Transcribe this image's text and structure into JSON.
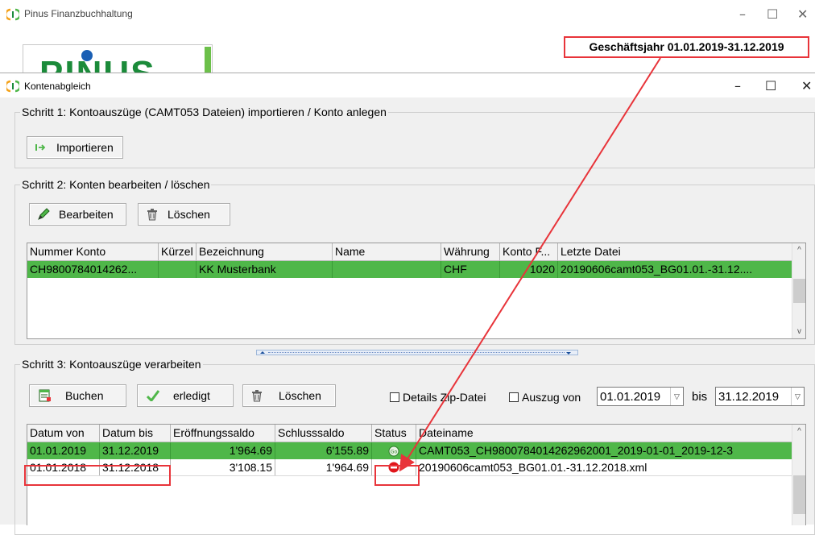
{
  "main_window": {
    "title": "Pinus Finanzbuchhaltung",
    "logo_text": "PINUS"
  },
  "annotation": {
    "fiscal_year": "Geschäftsjahr 01.01.2019-31.12.2019"
  },
  "dialog": {
    "title": "Kontenabgleich"
  },
  "step1": {
    "legend": "Schritt 1: Kontoauszüge (CAMT053 Dateien) importieren / Konto anlegen",
    "import_button": "Importieren"
  },
  "step2": {
    "legend": "Schritt 2: Konten bearbeiten / löschen",
    "edit_button": "Bearbeiten",
    "delete_button": "Löschen",
    "columns": [
      "Nummer Konto",
      "Kürzel",
      "Bezeichnung",
      "Name",
      "Währung",
      "Konto F...",
      "Letzte Datei"
    ],
    "rows": [
      [
        "CH9800784014262...",
        "",
        "KK Musterbank",
        "",
        "CHF",
        "1020",
        "20190606camt053_BG01.01.-31.12...."
      ]
    ]
  },
  "step3": {
    "legend": "Schritt 3: Kontoauszüge verarbeiten",
    "book_button": "Buchen",
    "done_button": "erledigt",
    "delete_button": "Löschen",
    "details_zip_label": "Details Zip-Datei",
    "statement_from_label": "Auszug von",
    "date_from": "01.01.2019",
    "until_label": "bis",
    "date_to": "31.12.2019",
    "columns": [
      "Datum von",
      "Datum bis",
      "Eröffnungssaldo",
      "Schlusssaldo",
      "Status",
      "Dateiname"
    ],
    "rows": [
      {
        "from": "01.01.2019",
        "to": "31.12.2019",
        "opening": "1'964.69",
        "closing": "6'155.89",
        "status": "go",
        "file": "CAMT053_CH9800784014262962001_2019-01-01_2019-12-3"
      },
      {
        "from": "01.01.2018",
        "to": "31.12.2018",
        "opening": "3'108.15",
        "closing": "1'964.69",
        "status": "blocked",
        "file": "20190606camt053_BG01.01.-31.12.2018.xml"
      }
    ]
  },
  "colors": {
    "row_highlight": "#4fb749",
    "annotation_red": "#e8343a",
    "logo_green": "#1b8b3a"
  }
}
